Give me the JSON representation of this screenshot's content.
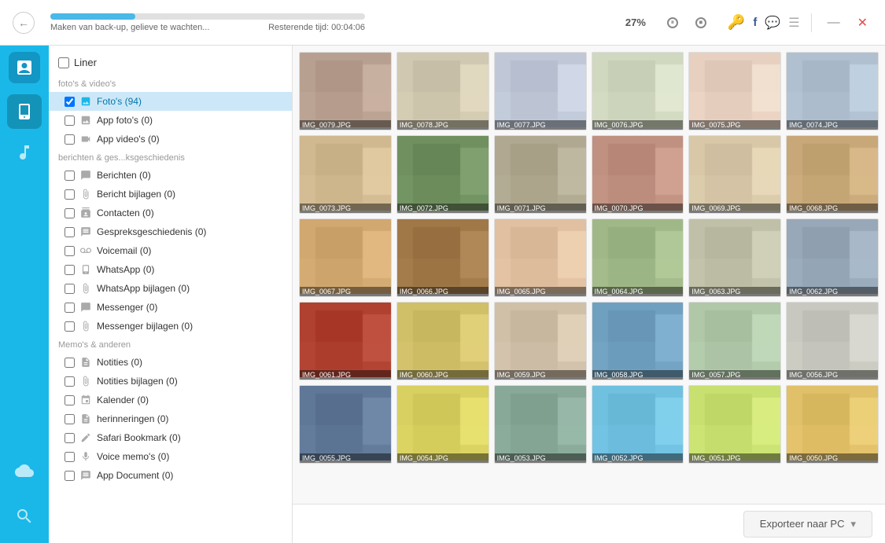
{
  "toolbar": {
    "progress_percent": "27%",
    "progress_width": "27%",
    "status_text": "Maken van back-up, gelieve te wachten...",
    "remaining_label": "Resterende tijd:",
    "remaining_time": "00:04:06",
    "pause_label": "⏸",
    "stop_label": "⏹"
  },
  "sidebar_icons": [
    {
      "id": "phone",
      "label": "📱",
      "active": true
    },
    {
      "id": "music",
      "label": "🎵",
      "active": false
    },
    {
      "id": "cloud",
      "label": "☁",
      "active": false
    },
    {
      "id": "tools",
      "label": "🔧",
      "active": false
    }
  ],
  "left_panel": {
    "header": "Liner",
    "sections": [
      {
        "label": "foto's & video's",
        "items": [
          {
            "id": "fotos",
            "label": "Foto's (94)",
            "icon": "⚙",
            "selected": true
          },
          {
            "id": "app-fotos",
            "label": "App foto's (0)",
            "icon": "□",
            "selected": false
          },
          {
            "id": "app-videos",
            "label": "App video's (0)",
            "icon": "▶",
            "selected": false
          }
        ]
      },
      {
        "label": "berichten & ges...ksgeschiedenis",
        "items": [
          {
            "id": "berichten",
            "label": "Berichten (0)",
            "icon": "💬",
            "selected": false
          },
          {
            "id": "bericht-bijlagen",
            "label": "Bericht bijlagen (0)",
            "icon": "📎",
            "selected": false
          },
          {
            "id": "contacten",
            "label": "Contacten (0)",
            "icon": "👤",
            "selected": false
          },
          {
            "id": "gespreks",
            "label": "Gespreksgeschiedenis (0)",
            "icon": "📋",
            "selected": false
          },
          {
            "id": "voicemail",
            "label": "Voicemail (0)",
            "icon": "📻",
            "selected": false
          },
          {
            "id": "whatsapp",
            "label": "WhatsApp (0)",
            "icon": "📱",
            "selected": false
          },
          {
            "id": "whatsapp-bijlagen",
            "label": "WhatsApp bijlagen (0)",
            "icon": "📎",
            "selected": false
          },
          {
            "id": "messenger",
            "label": "Messenger (0)",
            "icon": "💬",
            "selected": false
          },
          {
            "id": "messenger-bijlagen",
            "label": "Messenger bijlagen (0)",
            "icon": "📎",
            "selected": false
          }
        ]
      },
      {
        "label": "Memo's & anderen",
        "items": [
          {
            "id": "notities",
            "label": "Notities (0)",
            "icon": "📄",
            "selected": false
          },
          {
            "id": "notities-bijlagen",
            "label": "Notities bijlagen (0)",
            "icon": "📎",
            "selected": false
          },
          {
            "id": "kalender",
            "label": "Kalender (0)",
            "icon": "📅",
            "selected": false
          },
          {
            "id": "herinneringen",
            "label": "herinneringen (0)",
            "icon": "📄",
            "selected": false
          },
          {
            "id": "safari",
            "label": "Safari Bookmark (0)",
            "icon": "✏",
            "selected": false
          },
          {
            "id": "voice-memo",
            "label": "Voice memo's (0)",
            "icon": "🎤",
            "selected": false
          },
          {
            "id": "app-document",
            "label": "App Document (0)",
            "icon": "📋",
            "selected": false
          }
        ]
      }
    ]
  },
  "photos": [
    "IMG_0079.JPG",
    "IMG_0078.JPG",
    "IMG_0077.JPG",
    "IMG_0076.JPG",
    "IMG_0075.JPG",
    "IMG_0074.JPG",
    "IMG_0073.JPG",
    "IMG_0072.JPG",
    "IMG_0071.JPG",
    "IMG_0070.JPG",
    "IMG_0069.JPG",
    "IMG_0068.JPG",
    "IMG_0067.JPG",
    "IMG_0066.JPG",
    "IMG_0065.JPG",
    "IMG_0064.JPG",
    "IMG_0063.JPG",
    "IMG_0062.JPG",
    "IMG_0061.JPG",
    "IMG_0060.JPG",
    "IMG_0059.JPG",
    "IMG_0058.JPG",
    "IMG_0057.JPG",
    "IMG_0056.JPG",
    "IMG_0055.JPG",
    "IMG_0054.JPG",
    "IMG_0053.JPG",
    "IMG_0052.JPG",
    "IMG_0051.JPG",
    "IMG_0050.JPG"
  ],
  "photo_colors": [
    [
      "#c8a0b0",
      "#e8d8c0",
      "#b0c8d8",
      "#d8e8c0",
      "#f0d0c0",
      "#b8c8d8"
    ],
    [
      "#d8c0a8",
      "#88a870",
      "#c0b8a0",
      "#c8a890",
      "#e0d0b8",
      "#d0b898"
    ],
    [
      "#d8c890",
      "#b09878",
      "#e8c8b0",
      "#b8c0a0",
      "#c8c8b0",
      "#a8b8c0"
    ],
    [
      "#c85030",
      "#d8c870",
      "#d8c8b0",
      "#78a8c8",
      "#c8d8b8",
      "#d8d8d0"
    ],
    [
      "#6080a0",
      "#e0d870",
      "#90b0a0",
      "#78c8e8",
      "#d0e880",
      "#e8c870"
    ]
  ],
  "export_button": "Exporteer naar PC"
}
